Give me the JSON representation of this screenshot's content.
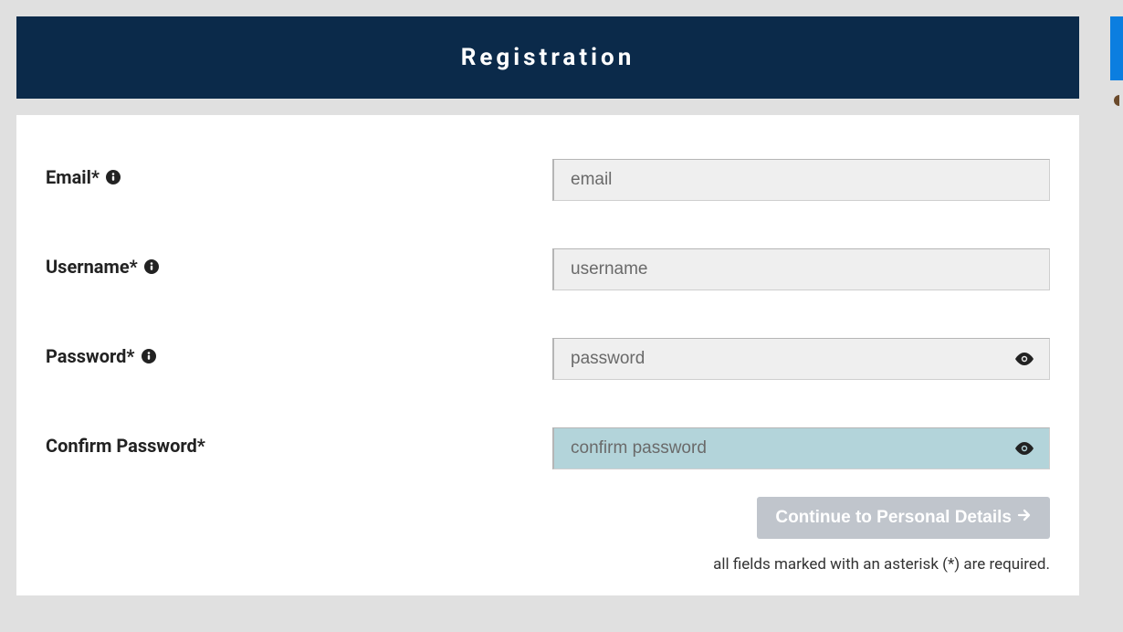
{
  "header": {
    "title": "Registration"
  },
  "form": {
    "email": {
      "label": "Email*",
      "placeholder": "email",
      "value": ""
    },
    "username": {
      "label": "Username*",
      "placeholder": "username",
      "value": ""
    },
    "password": {
      "label": "Password*",
      "placeholder": "password",
      "value": ""
    },
    "confirm_password": {
      "label": "Confirm Password*",
      "placeholder": "confirm password",
      "value": ""
    }
  },
  "actions": {
    "continue_label": "Continue to Personal Details"
  },
  "note": "all fields marked with an asterisk (*) are required."
}
